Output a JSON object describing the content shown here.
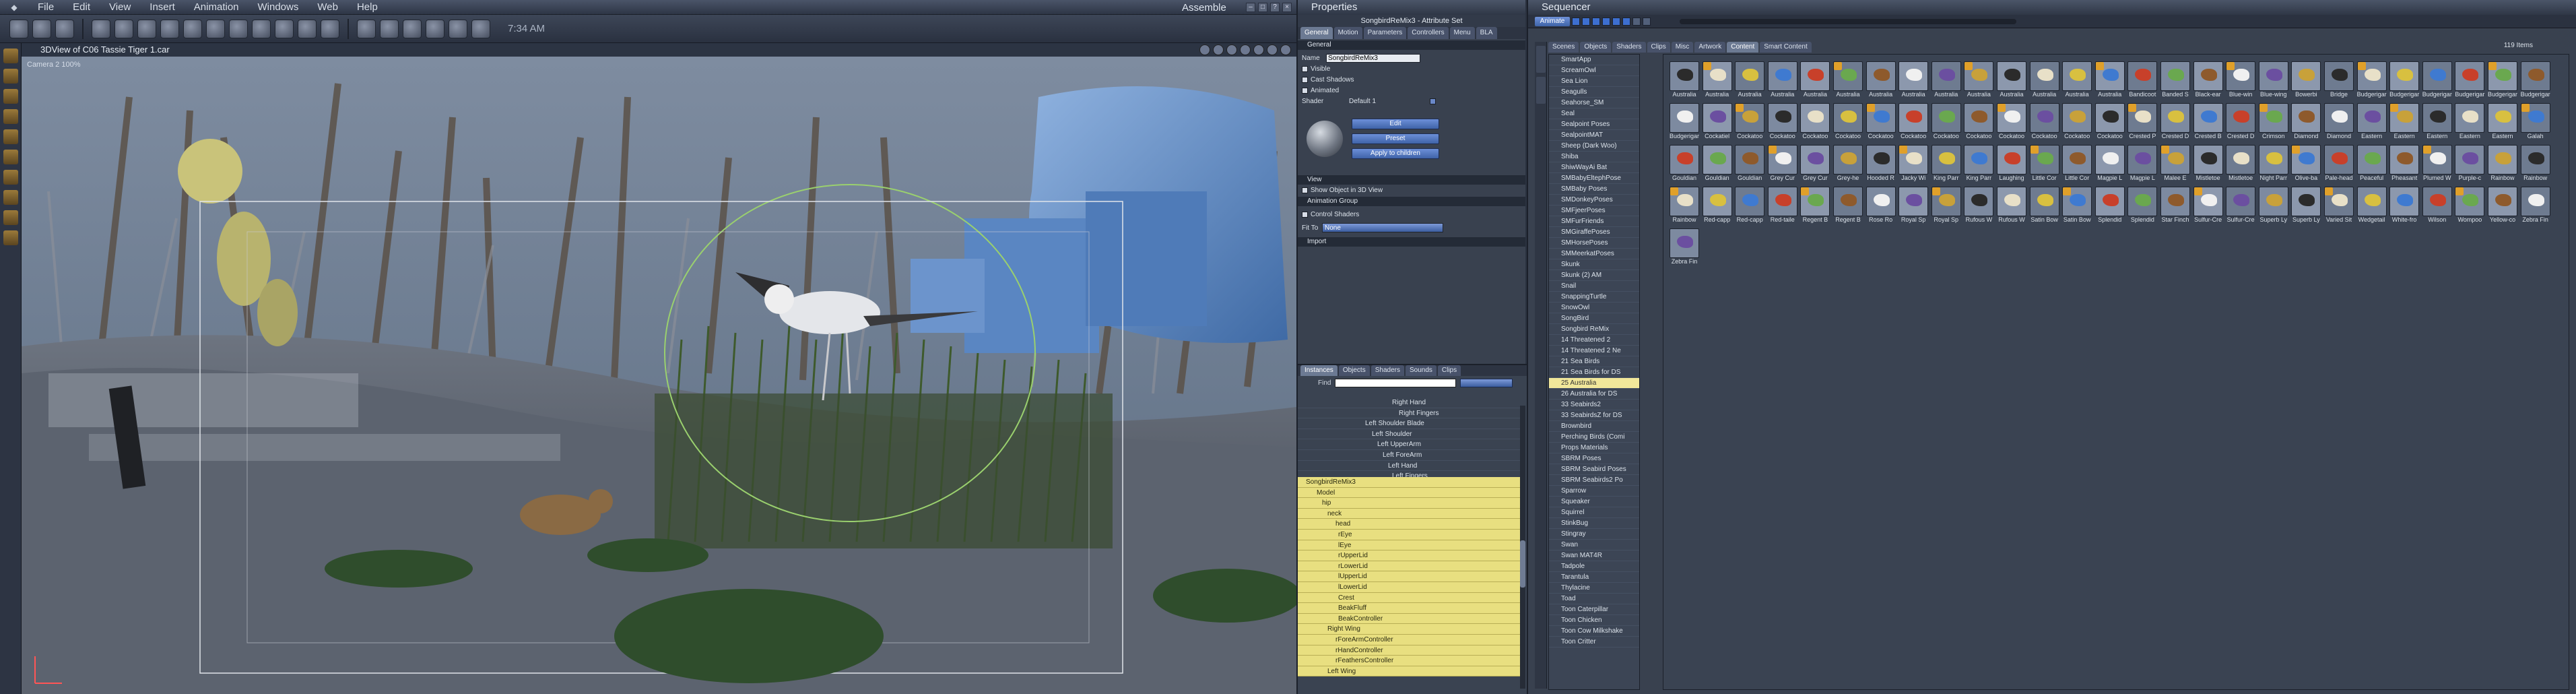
{
  "app": {
    "menu": [
      "File",
      "Edit",
      "View",
      "Insert",
      "Animation",
      "Windows",
      "Web",
      "Help"
    ],
    "mode": "Assemble",
    "clock": "7:34 AM"
  },
  "viewport": {
    "title": "3DView of C06 Tassie Tiger 1.car",
    "camera": "Camera 2 100%"
  },
  "properties": {
    "title": "Properties",
    "subtitle": "SongbirdReMix3 - Attribute Set",
    "tabs": [
      "General",
      "Motion",
      "Parameters",
      "Controllers",
      "Menu",
      "BLA"
    ],
    "general_header": "General",
    "name_label": "Name",
    "name_value": "SongbirdReMix3",
    "visible": "Visible",
    "cast_shadows": "Cast Shadows",
    "animated": "Animated",
    "shader_label": "Shader",
    "shader_value": "Default 1",
    "edit_button": "Edit",
    "preset_button": "Preset",
    "apply_button": "Apply to children",
    "view_header": "View",
    "show_in_3d": "Show Object in 3D View",
    "anim_group_header": "Animation Group",
    "control_shaders": "Control Shaders",
    "fit_to_label": "Fit To",
    "fit_to_value": "None",
    "import_header": "Import"
  },
  "instances": {
    "tabs": [
      "Instances",
      "Objects",
      "Shaders",
      "Sounds",
      "Clips"
    ],
    "find_label": "Find",
    "tree_top": [
      "Right Hand",
      "Right Fingers",
      "Left Shoulder Blade",
      "Left Shoulder",
      "Left UpperArm",
      "Left ForeArm",
      "Left Hand",
      "Left Fingers"
    ],
    "tree_yellow": [
      "SongbirdReMix3",
      "Model",
      "hip",
      "neck",
      "head",
      "rEye",
      "lEye",
      "rUpperLid",
      "rLowerLid",
      "lUpperLid",
      "lLowerLid",
      "Crest",
      "BeakFluff",
      "BeakController",
      "Right Wing",
      "rForeArmController",
      "rHandController",
      "rFeathersController",
      "Left Wing"
    ]
  },
  "sequencer": {
    "title": "Sequencer",
    "animate_label": "Animate",
    "tabs": [
      "Scenes",
      "Objects",
      "Shaders",
      "Clips",
      "Misc",
      "Artwork",
      "Content",
      "Smart Content"
    ],
    "item_count": "119 Items",
    "list": [
      "SmartApp",
      "ScreamOwl",
      "Sea Lion",
      "Seagulls",
      "Seahorse_SM",
      "Seal",
      "Sealpoint Poses",
      "SealpointMAT",
      "Sheep (Dark Woo)",
      "Shiba",
      "ShiwWayAi Bat",
      "SMBabyEltephPose",
      "SMBaby Poses",
      "SMDonkeyPoses",
      "SMFjeerPoses",
      "SMFurFriends",
      "SMGiraffePoses",
      "SMHorsePoses",
      "SMMeerkatPoses",
      "Skunk",
      "Skunk (2) AM",
      "Snail",
      "SnappingTurtle",
      "SnowOwl",
      "SongBird",
      "Songbird ReMix",
      "14 Threatened 2",
      "14 Threatened 2 Ne",
      "21 Sea Birds",
      "21 Sea Birds for DS",
      "25 Australia",
      "26 Australia for DS",
      "33 Seabirds2",
      "33 SeabirdsZ for DS",
      "Brownbird",
      "Perching Birds (Comi",
      "Props Materials",
      "SBRM Poses",
      "SBRM Seabird Poses",
      "SBRM Seabirds2 Po",
      "Sparrow",
      "Squeaker",
      "Squirrel",
      "StinkBug",
      "Stingray",
      "Swan",
      "Swan MAT4R",
      "Tadpole",
      "Tarantula",
      "Thylacine",
      "Toad",
      "Toon Caterpillar",
      "Toon Chicken",
      "Toon Cow Milkshake",
      "Toon Critter"
    ],
    "selected_list_index": 30,
    "captions": [
      "Australia",
      "Australia",
      "Australia",
      "Australia",
      "Australia",
      "Australia",
      "Australia",
      "Australia",
      "Australia",
      "Australia",
      "Australia",
      "Australia",
      "Australia",
      "Australia",
      "Bandicoot",
      "Banded S",
      "Black-ear",
      "Blue-win",
      "Blue-wing",
      "Bowerbi",
      "Bridge",
      "Budgerigar",
      "Budgerigar",
      "Budgerigar",
      "Budgerigar",
      "Budgerigar",
      "Budgerigar",
      "Budgerigar",
      "Cockatiel",
      "Cockatoo",
      "Cockatoo",
      "Cockatoo",
      "Cockatoo",
      "Cockatoo",
      "Cockatoo",
      "Cockatoo",
      "Cockatoo",
      "Cockatoo",
      "Cockatoo",
      "Cockatoo",
      "Cockatoo",
      "Crested P",
      "Crested D",
      "Crested B",
      "Crested D",
      "Crimson",
      "Diamond",
      "Diamond",
      "Eastern",
      "Eastern",
      "Eastern",
      "Eastern",
      "Eastern",
      "Galah",
      "Gouldian",
      "Gouldian",
      "Gouldian",
      "Grey Cur",
      "Grey Cur",
      "Grey-he",
      "Hooded R",
      "Jacky Wi",
      "King Parr",
      "King Parr",
      "Laughing",
      "Little Cor",
      "Little Cor",
      "Magpie L",
      "Magpie L",
      "Malee E",
      "Mistletoe",
      "Mistletoe",
      "Night Parr",
      "Olive-ba",
      "Pale-head",
      "Peaceful",
      "Pheasant",
      "Plumed W",
      "Purple-c",
      "Rainbow",
      "Rainbow",
      "Rainbow",
      "Red-capp",
      "Red-capp",
      "Red-taile",
      "Regent B",
      "Regent B",
      "Rose Ro",
      "Royal Sp",
      "Royal Sp",
      "Rufous W",
      "Rufous W",
      "Satin Bow",
      "Satin Bow",
      "Splendid",
      "Splendid",
      "Star Finch",
      "Sulfur-Cre",
      "Sulfur-Cre",
      "Superb Ly",
      "Superb Ly",
      "Varied Sit",
      "Wedgetail",
      "White-fro",
      "Wilson",
      "Wompoo",
      "Yellow-co",
      "Zebra Fin",
      "Zebra Fin"
    ]
  },
  "colors": {
    "accent": "#3d6fd0",
    "tree_highlight": "#e8df80",
    "panel": "#39414f"
  }
}
